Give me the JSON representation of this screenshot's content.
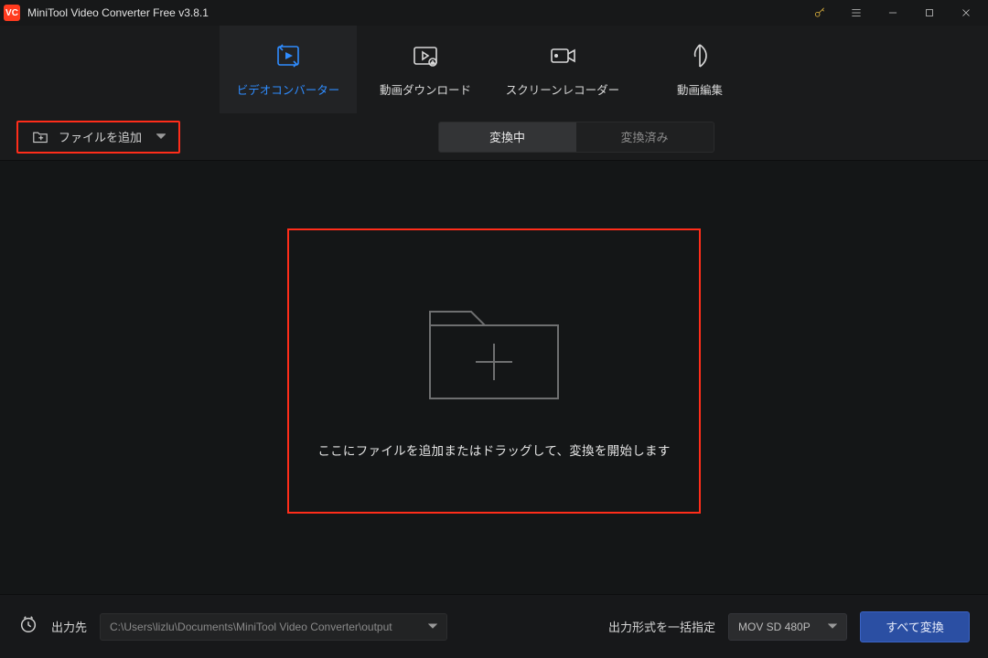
{
  "titlebar": {
    "app_title": "MiniTool Video Converter Free v3.8.1"
  },
  "tabs": {
    "converter": "ビデオコンバーター",
    "download": "動画ダウンロード",
    "recorder": "スクリーンレコーダー",
    "editor": "動画編集"
  },
  "toolbar": {
    "add_file_label": "ファイルを追加",
    "seg_converting": "変換中",
    "seg_done": "変換済み"
  },
  "dropzone": {
    "text": "ここにファイルを追加またはドラッグして、変換を開始します"
  },
  "footer": {
    "output_dir_label": "出力先",
    "output_dir_value": "C:\\Users\\lizlu\\Documents\\MiniTool Video Converter\\output",
    "batch_format_label": "出力形式を一括指定",
    "batch_format_value": "MOV SD 480P",
    "convert_all_label": "すべて変換"
  },
  "colors": {
    "accent_blue": "#2f8cff",
    "highlight_red": "#ff2d1a",
    "primary_button": "#2b4fa3"
  }
}
